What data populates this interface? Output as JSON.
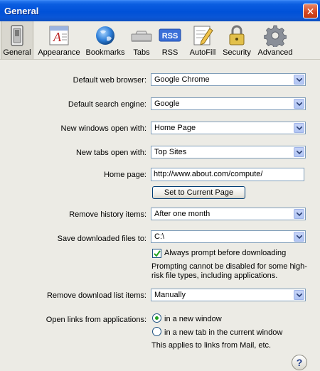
{
  "window": {
    "title": "General",
    "close_glyph": "✕"
  },
  "toolbar": {
    "items": [
      {
        "label": "General",
        "icon": "switch-icon",
        "selected": true
      },
      {
        "label": "Appearance",
        "icon": "font-icon",
        "selected": false
      },
      {
        "label": "Bookmarks",
        "icon": "globe-icon",
        "selected": false
      },
      {
        "label": "Tabs",
        "icon": "tabs-icon",
        "selected": false
      },
      {
        "label": "RSS",
        "icon": "rss-icon",
        "badge": "RSS",
        "selected": false
      },
      {
        "label": "AutoFill",
        "icon": "pencil-form-icon",
        "selected": false
      },
      {
        "label": "Security",
        "icon": "lock-icon",
        "selected": false
      },
      {
        "label": "Advanced",
        "icon": "gear-icon",
        "selected": false
      }
    ]
  },
  "form": {
    "default_browser": {
      "label": "Default web browser:",
      "value": "Google Chrome"
    },
    "default_search": {
      "label": "Default search engine:",
      "value": "Google"
    },
    "new_windows": {
      "label": "New windows open with:",
      "value": "Home Page"
    },
    "new_tabs": {
      "label": "New tabs open with:",
      "value": "Top Sites"
    },
    "home_page": {
      "label": "Home page:",
      "value": "http://www.about.com/compute/"
    },
    "set_current_page": {
      "label": "Set to Current Page"
    },
    "remove_history": {
      "label": "Remove history items:",
      "value": "After one month"
    },
    "save_downloads": {
      "label": "Save downloaded files to:",
      "value": "C:\\"
    },
    "always_prompt": {
      "label": "Always prompt before downloading",
      "checked": true
    },
    "prompt_note": "Prompting cannot be disabled for some high-risk file types, including applications.",
    "remove_download_list": {
      "label": "Remove download list items:",
      "value": "Manually"
    },
    "open_links": {
      "label": "Open links from applications:",
      "options": [
        {
          "label": "in a new window",
          "selected": true
        },
        {
          "label": "in a new tab in the current window",
          "selected": false
        }
      ],
      "note": "This applies to links from Mail, etc."
    }
  },
  "help": {
    "label": "?"
  },
  "colors": {
    "titlebar": "#0051d8",
    "background": "#ecebe5",
    "field_border": "#7f9db9",
    "radio_dot": "#21a121"
  }
}
